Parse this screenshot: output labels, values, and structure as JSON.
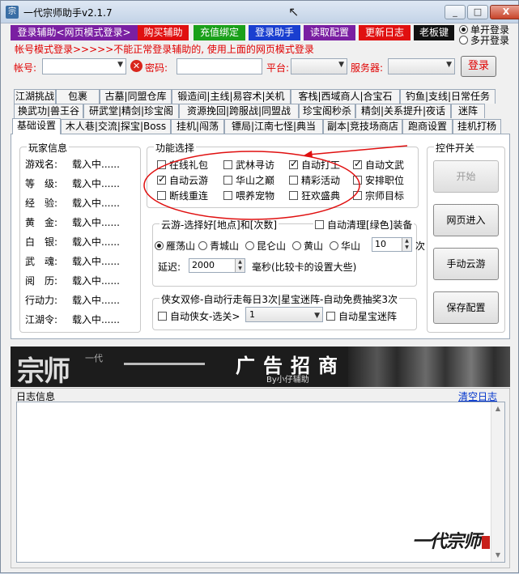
{
  "window": {
    "title": "一代宗师助手v2.1.7",
    "controls": [
      "_",
      "□",
      "X"
    ]
  },
  "toolbar": {
    "buttons": [
      {
        "label": "登录辅助<网页模式登录>",
        "color": "#7a1fa2"
      },
      {
        "label": "购买辅助",
        "color": "#e01010"
      },
      {
        "label": "充值绑定",
        "color": "#1aa01a"
      },
      {
        "label": "登录助手",
        "color": "#1a3fd0"
      },
      {
        "label": "读取配置",
        "color": "#7a1fa2"
      },
      {
        "label": "更新日志",
        "color": "#e01010"
      },
      {
        "label": "老板键",
        "color": "#111111"
      }
    ],
    "login_mode": {
      "single": "单开登录",
      "multi": "多开登录",
      "selected": "single"
    }
  },
  "notice": "帐号模式登录>>>>>不能正常登录辅助的, 使用上面的网页模式登录",
  "login": {
    "account_label": "帐号:",
    "password_label": "密码:",
    "platform_label": "平台:",
    "server_label": "服务器:",
    "login_button": "登录"
  },
  "tabs": {
    "row1": [
      "江湖挑战",
      "包裹",
      "古墓|同盟仓库",
      "锻造间|主线|易容术|关机",
      "客栈|西域商人|合宝石",
      "钓鱼|支线|日常任务"
    ],
    "row2": [
      "换武功|兽王谷",
      "研武堂|精剑|珍宝阁",
      "资源挽回|跨服战|同盟战",
      "珍宝阁秒杀",
      "精剑|关系提升|夜话",
      "迷阵"
    ],
    "row3": [
      "基础设置",
      "木人巷|交流|探宝|Boss",
      "挂机|闯荡",
      "镖局|江南七怪|典当",
      "副本|竞技场商店",
      "跑商设置",
      "挂机打杨"
    ],
    "active": "基础设置"
  },
  "player_info": {
    "title": "玩家信息",
    "rows": [
      {
        "label": "游戏名:",
        "value": "载入中......"
      },
      {
        "label": "等　级:",
        "value": "载入中......"
      },
      {
        "label": "经　验:",
        "value": "载入中......"
      },
      {
        "label": "黄　金:",
        "value": "载入中......"
      },
      {
        "label": "白　银:",
        "value": "载入中......"
      },
      {
        "label": "武　魂:",
        "value": "载入中......"
      },
      {
        "label": "阅　历:",
        "value": "载入中......"
      },
      {
        "label": "行动力:",
        "value": "载入中......"
      },
      {
        "label": "江湖令:",
        "value": "载入中......"
      }
    ]
  },
  "features": {
    "title": "功能选择",
    "items": [
      {
        "label": "在线礼包",
        "checked": false
      },
      {
        "label": "武林寻访",
        "checked": false
      },
      {
        "label": "自动打工",
        "checked": true
      },
      {
        "label": "自动文武",
        "checked": true
      },
      {
        "label": "自动云游",
        "checked": true
      },
      {
        "label": "华山之巅",
        "checked": false
      },
      {
        "label": "精彩活动",
        "checked": false
      },
      {
        "label": "安排职位",
        "checked": false
      },
      {
        "label": "断线重连",
        "checked": false
      },
      {
        "label": "喂养宠物",
        "checked": false
      },
      {
        "label": "狂欢盛典",
        "checked": false
      },
      {
        "label": "宗师目标",
        "checked": false
      }
    ]
  },
  "cloud_travel": {
    "title": "云游-选择好[地点]和[次数]",
    "auto_clean_label": "自动清理[绿色]装备",
    "auto_clean_checked": false,
    "locations": [
      "雁荡山",
      "青城山",
      "昆仑山",
      "黄山",
      "华山"
    ],
    "selected_location": "雁荡山",
    "count": "10",
    "count_unit": "次",
    "delay_label": "延迟:",
    "delay_value": "2000",
    "delay_hint": "毫秒(比较卡的设置大些)"
  },
  "partner": {
    "title": "侠女双修-自动行走每日3次|星宝迷阵-自动免费抽奖3次",
    "auto_partner_label": "自动侠女-选关>",
    "auto_partner_checked": false,
    "stage_value": "1",
    "auto_star_label": "自动星宝迷阵",
    "auto_star_checked": false
  },
  "controls": {
    "title": "控件开关",
    "buttons": [
      {
        "label": "开始",
        "enabled": false
      },
      {
        "label": "网页进入",
        "enabled": true
      },
      {
        "label": "手动云游",
        "enabled": true
      },
      {
        "label": "保存配置",
        "enabled": true
      }
    ]
  },
  "banner": {
    "brush_text": "宗师",
    "brush_sub": "一代",
    "ad_text": "广告招商",
    "by_text": "By小仔辅助"
  },
  "log": {
    "title": "日志信息",
    "clear_link": "清空日志"
  },
  "watermark": "一代宗师"
}
